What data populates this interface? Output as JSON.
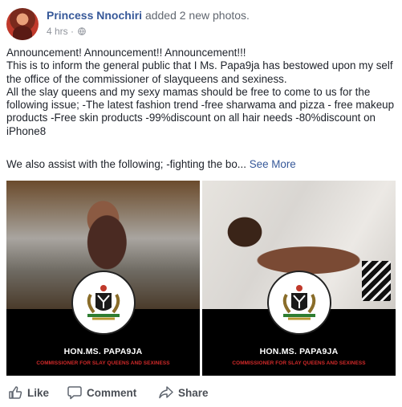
{
  "post": {
    "author": "Princess Nnochiri",
    "action_text": "added 2 new photos.",
    "timestamp": "4 hrs",
    "separator": "·",
    "privacy_icon": "globe-icon",
    "paragraphs": [
      "Announcement! Announcement!! Announcement!!!",
      "This is to inform the general public that I Ms. Papa9ja has bestowed upon my self the office of the commissioner of slayqueens and sexiness.",
      "All the slay queens and my sexy mamas should be free to come to us for the following issue; -The latest fashion trend -free sharwama and pizza - free makeup products -Free skin products -99%discount on all hair needs -80%discount on iPhone8"
    ],
    "truncated_text": "We also assist with the following; -fighting the bo...",
    "see_more": "See More"
  },
  "photos": [
    {
      "name": "HON.MS. PAPA9JA",
      "title": "COMMISSIONER FOR SLAY QUEENS AND SEXINESS"
    },
    {
      "name": "HON.MS. PAPA9JA",
      "title": "COMMISSIONER FOR SLAY QUEENS AND SEXINESS"
    }
  ],
  "actions": {
    "like": "Like",
    "comment": "Comment",
    "share": "Share"
  },
  "colors": {
    "link": "#365899",
    "meta": "#90949c",
    "caption_red": "#d42a2a"
  }
}
